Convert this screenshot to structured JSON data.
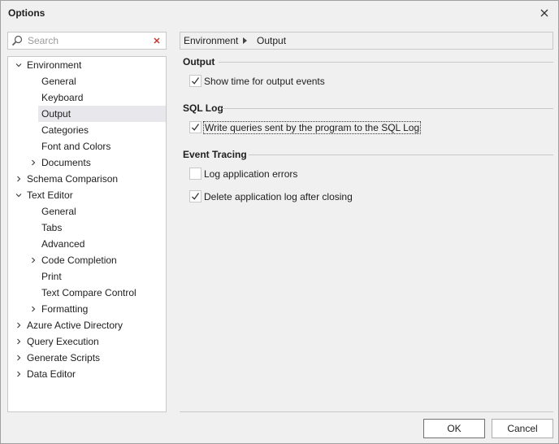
{
  "window": {
    "title": "Options"
  },
  "search": {
    "placeholder": "Search",
    "value": ""
  },
  "tree": [
    {
      "label": "Environment",
      "level": 0,
      "expander": "expanded"
    },
    {
      "label": "General",
      "level": 1,
      "expander": "none"
    },
    {
      "label": "Keyboard",
      "level": 1,
      "expander": "none"
    },
    {
      "label": "Output",
      "level": 1,
      "expander": "none",
      "selected": true
    },
    {
      "label": "Categories",
      "level": 1,
      "expander": "none"
    },
    {
      "label": "Font and Colors",
      "level": 1,
      "expander": "none"
    },
    {
      "label": "Documents",
      "level": 1,
      "expander": "collapsed"
    },
    {
      "label": "Schema Comparison",
      "level": 0,
      "expander": "collapsed"
    },
    {
      "label": "Text Editor",
      "level": 0,
      "expander": "expanded"
    },
    {
      "label": "General",
      "level": 1,
      "expander": "none"
    },
    {
      "label": "Tabs",
      "level": 1,
      "expander": "none"
    },
    {
      "label": "Advanced",
      "level": 1,
      "expander": "none"
    },
    {
      "label": "Code Completion",
      "level": 1,
      "expander": "collapsed"
    },
    {
      "label": "Print",
      "level": 1,
      "expander": "none"
    },
    {
      "label": "Text Compare Control",
      "level": 1,
      "expander": "none"
    },
    {
      "label": "Formatting",
      "level": 1,
      "expander": "collapsed"
    },
    {
      "label": "Azure Active Directory",
      "level": 0,
      "expander": "collapsed"
    },
    {
      "label": "Query Execution",
      "level": 0,
      "expander": "collapsed"
    },
    {
      "label": "Generate Scripts",
      "level": 0,
      "expander": "collapsed"
    },
    {
      "label": "Data Editor",
      "level": 0,
      "expander": "collapsed"
    }
  ],
  "breadcrumb": {
    "items": [
      "Environment",
      "Output"
    ]
  },
  "groups": {
    "output": {
      "header": "Output",
      "options": [
        {
          "label": "Show time for output events",
          "checked": true
        }
      ]
    },
    "sql_log": {
      "header": "SQL Log",
      "options": [
        {
          "label": "Write queries sent by the program to the SQL Log",
          "checked": true,
          "focused": true
        }
      ]
    },
    "event_tracing": {
      "header": "Event Tracing",
      "options": [
        {
          "label": "Log application errors",
          "checked": false
        },
        {
          "label": "Delete application log after closing",
          "checked": true
        }
      ]
    }
  },
  "buttons": {
    "ok": "OK",
    "cancel": "Cancel"
  },
  "colors": {
    "selected_row": "#e8e8ec",
    "border": "#c8c8c8",
    "background": "#f0f0f0",
    "clear_icon": "#c0392b"
  }
}
